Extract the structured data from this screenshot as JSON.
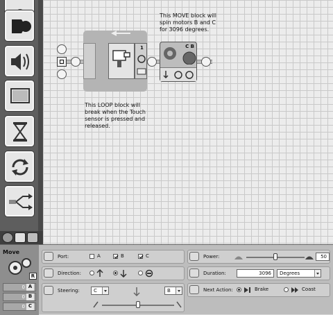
{
  "canvas": {
    "move_comment": "This MOVE block will\nspin motors B and C\nfor 3096 degrees.",
    "loop_comment": "This LOOP block will\nbreak when the Touch\nsensor is pressed and\nreleased.",
    "loop_counter": "1",
    "move_ports": "C B"
  },
  "palette": {
    "items": [
      "move-icon",
      "sound-icon",
      "display-icon",
      "wait-icon",
      "loop-icon",
      "switch-icon"
    ]
  },
  "config": {
    "title": "Move",
    "port_values": [
      {
        "value": "0",
        "letter": "A"
      },
      {
        "value": "0",
        "letter": "B"
      },
      {
        "value": "0",
        "letter": "C"
      }
    ],
    "port_selected": "R",
    "port": {
      "label": "Port:",
      "a": "A",
      "b": "B",
      "c": "C",
      "b_checked": true,
      "c_checked": true,
      "a_checked": false
    },
    "direction": {
      "label": "Direction:"
    },
    "steering": {
      "label": "Steering:",
      "left": "C",
      "right": "B"
    },
    "power": {
      "label": "Power:",
      "value": "50",
      "level_percent": 50
    },
    "duration": {
      "label": "Duration:",
      "value": "3096",
      "unit": "Degrees"
    },
    "next_action": {
      "label": "Next Action:",
      "brake": "Brake",
      "coast": "Coast"
    }
  }
}
